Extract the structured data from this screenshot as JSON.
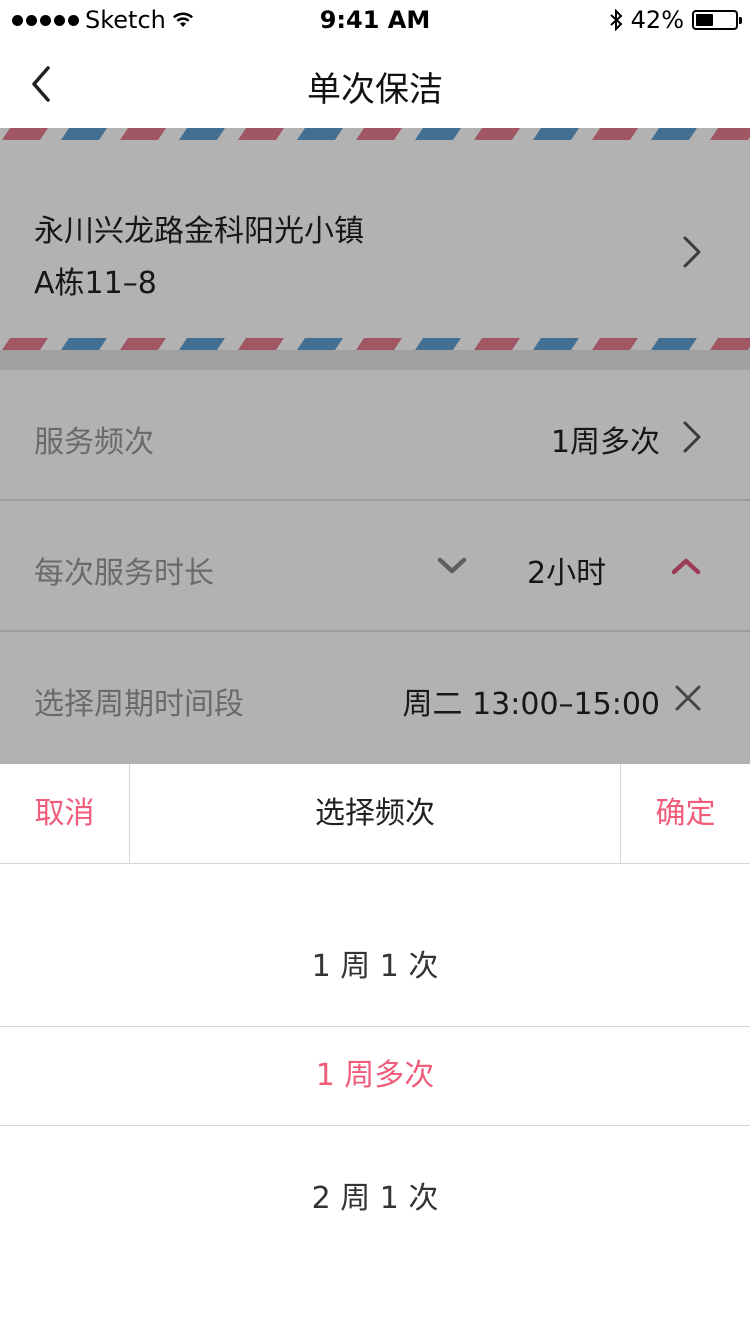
{
  "status_bar": {
    "carrier": "Sketch",
    "time": "9:41 AM",
    "battery": "42%",
    "icons": [
      "signal-dots-icon",
      "wifi-icon",
      "bluetooth-icon",
      "battery-icon"
    ]
  },
  "nav": {
    "title": "单次保洁",
    "back_icon": "chevron-left-icon"
  },
  "address": {
    "line1": "永川兴龙路金科阳光小镇",
    "line2": "A栋11–8"
  },
  "rows": {
    "frequency": {
      "label": "服务频次",
      "value": "1周多次"
    },
    "duration": {
      "label": "每次服务时长",
      "value": "2小时"
    },
    "period": {
      "label": "选择周期时间段",
      "value": "周二 13:00–15:00"
    }
  },
  "picker": {
    "cancel_label": "取消",
    "title": "选择频次",
    "confirm_label": "确定",
    "options": [
      "1 周 1 次",
      "1 周多次",
      "2 周 1 次"
    ],
    "selected": "1 周多次"
  },
  "colors": {
    "accent": "#ef5d7b",
    "stripe_red": "#e57c8f",
    "stripe_blue": "#5f9fd1",
    "overlay": "rgba(0,0,0,0.30)"
  }
}
